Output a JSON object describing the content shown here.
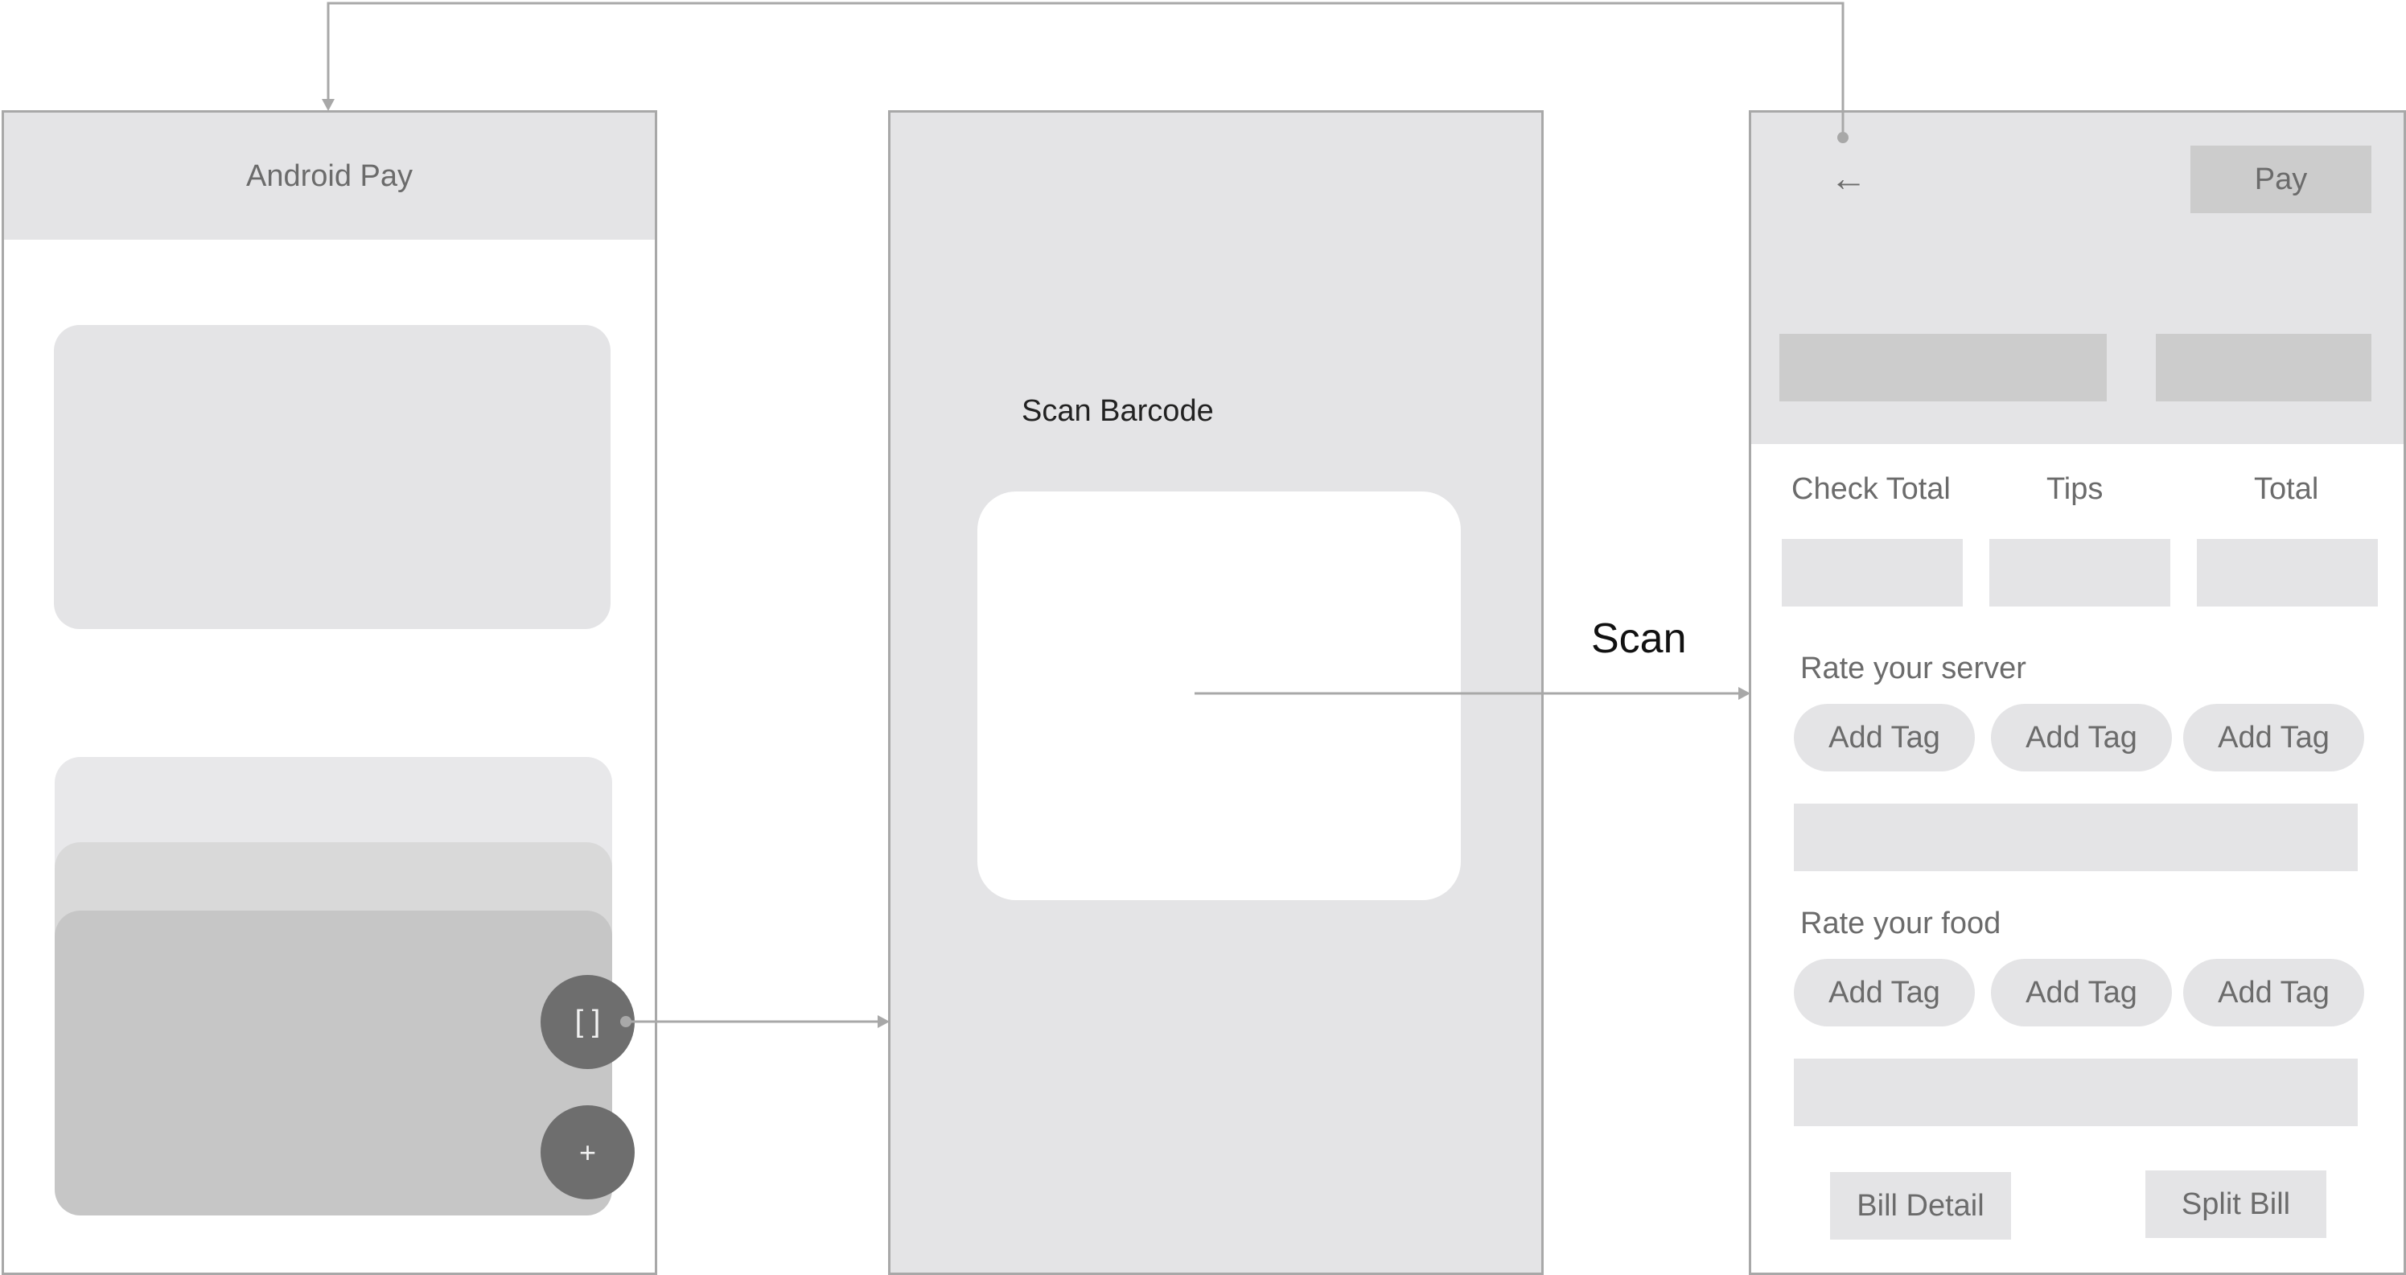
{
  "screen1": {
    "title": "Android Pay",
    "scan_fab_label": "[ ]",
    "add_fab_label": "+"
  },
  "screen2": {
    "title": "Scan Barcode"
  },
  "flow": {
    "scan_label": "Scan"
  },
  "screen3": {
    "back_icon": "←",
    "pay_label": "Pay",
    "col_check_total": "Check Total",
    "col_tips": "Tips",
    "col_total": "Total",
    "rate_server": "Rate your server",
    "rate_food": "Rate your food",
    "server_tags": [
      "Add Tag",
      "Add Tag",
      "Add Tag"
    ],
    "food_tags": [
      "Add Tag",
      "Add Tag",
      "Add Tag"
    ],
    "bill_detail_label": "Bill Detail",
    "split_bill_label": "Split Bill"
  },
  "colors": {
    "line": "#a8a8a8",
    "panel": "#e4e4e6",
    "fab": "#6e6e6e"
  }
}
